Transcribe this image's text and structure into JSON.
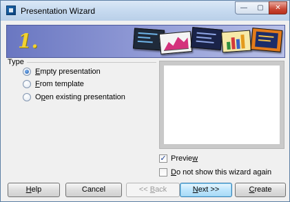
{
  "window": {
    "title": "Presentation Wizard",
    "controls": {
      "minimize": "—",
      "maximize": "▢",
      "close": "✕"
    }
  },
  "banner": {
    "step": "1.",
    "colors": {
      "gradient_start": "#6a77c1",
      "gradient_end": "#b8c0e8",
      "step_number": "#f2d22e"
    }
  },
  "type_group": {
    "label": "Type",
    "options": [
      {
        "pre": "",
        "key": "E",
        "post": "mpty presentation",
        "checked": true
      },
      {
        "pre": "",
        "key": "F",
        "post": "rom template",
        "checked": false
      },
      {
        "pre": "O",
        "key": "p",
        "post": "en existing presentation",
        "checked": false
      }
    ]
  },
  "preview_checkbox": {
    "pre": "Previe",
    "key": "w",
    "post": "",
    "checked": true
  },
  "no_show_checkbox": {
    "pre": "",
    "key": "D",
    "post": "o not show this wizard again",
    "checked": false
  },
  "buttons": {
    "help": {
      "pre": "",
      "key": "H",
      "post": "elp"
    },
    "cancel": {
      "label": "Cancel"
    },
    "back": {
      "pre": "<< ",
      "key": "B",
      "post": "ack"
    },
    "next": {
      "pre": "",
      "key": "N",
      "post": "ext >>"
    },
    "create": {
      "pre": "",
      "key": "C",
      "post": "reate"
    }
  }
}
